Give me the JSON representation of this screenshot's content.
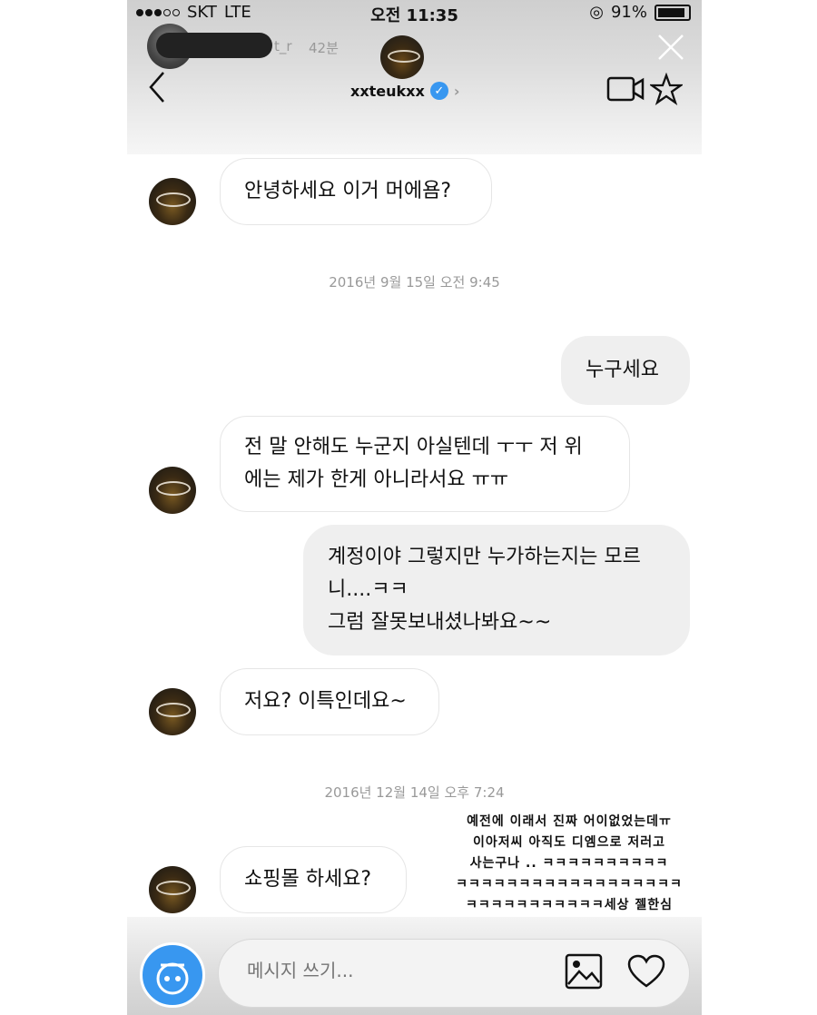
{
  "status_bar": {
    "carrier": "SKT",
    "network": "LTE",
    "time": "오전 11:35",
    "battery": "91%"
  },
  "story": {
    "username_fragment": "t_r",
    "time_ago": "42분"
  },
  "header": {
    "username": "xxteukxx",
    "verified_icon": "verified-badge-icon",
    "chevron": "›"
  },
  "messages": [
    {
      "side": "them",
      "lines": [
        "안녕하세요 이거 머에욤?"
      ]
    },
    {
      "side": "timestamp",
      "text": "2016년 9월 15일 오전 9:45"
    },
    {
      "side": "me",
      "lines": [
        "누구세요"
      ]
    },
    {
      "side": "them",
      "lines": [
        "전 말 안해도 누군지 아실텐데 ㅜㅜ 저 위",
        "에는 제가 한게 아니라서요 ㅠㅠ"
      ]
    },
    {
      "side": "me",
      "lines": [
        "계정이야 그렇지만 누가하는지는 모르",
        "니....ㅋㅋ",
        "그럼 잘못보내셨나봐요~~"
      ]
    },
    {
      "side": "them",
      "lines": [
        "저요? 이특인데요~"
      ]
    },
    {
      "side": "timestamp",
      "text": "2016년 12월 14일 오후 7:24"
    },
    {
      "side": "them",
      "lines": [
        "쇼핑몰 하세요?"
      ]
    }
  ],
  "caption": {
    "lines": [
      "예전에 이래서 진짜 어이없었는데ㅠ",
      "이아저씨 아직도 디엠으로 저러고",
      "사는구나 .. ㅋㅋㅋㅋㅋㅋㅋㅋㅋㅋ",
      "ㅋㅋㅋㅋㅋㅋㅋㅋㅋㅋㅋㅋㅋㅋㅋㅋㅋㅋ",
      "ㅋㅋㅋㅋㅋㅋㅋㅋㅋㅋㅋ세상 젤한심"
    ]
  },
  "input": {
    "placeholder": "메시지 쓰기..."
  },
  "colors": {
    "verified_blue": "#3897f0",
    "bubble_me": "#efefef",
    "timestamp": "#999999"
  },
  "icons": [
    "back-icon",
    "video-call-icon",
    "star-icon",
    "close-icon",
    "camera-icon",
    "gallery-icon",
    "heart-icon"
  ]
}
